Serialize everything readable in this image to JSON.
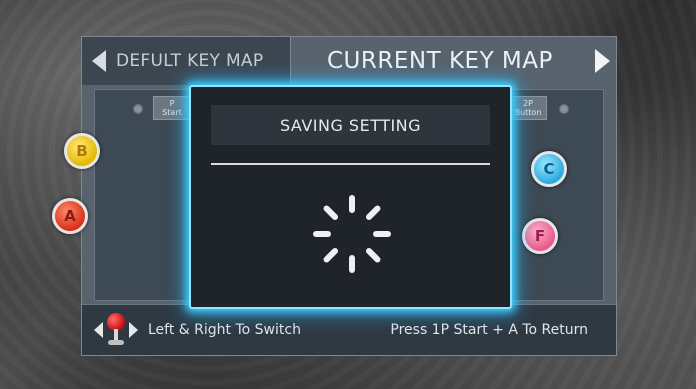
{
  "tabs": {
    "inactive_label": "DEFULT KEY MAP",
    "active_label": "CURRENT KEY MAP"
  },
  "keymap": {
    "left_small_label": "P\nStart",
    "right_small_label": "2P\nButton",
    "buttons": [
      {
        "id": "b",
        "letter": "B",
        "color": "#f0c400"
      },
      {
        "id": "a",
        "letter": "A",
        "color": "#e03a1f"
      },
      {
        "id": "c",
        "letter": "C",
        "color": "#2aa9e0"
      },
      {
        "id": "f",
        "letter": "F",
        "color": "#e75a8a"
      }
    ]
  },
  "dialog": {
    "title": "SAVING SETTING",
    "glow_color": "#3fd0ff"
  },
  "footer": {
    "left_hint": "Left & Right To Switch",
    "right_hint": "Press 1P Start + A To Return"
  }
}
